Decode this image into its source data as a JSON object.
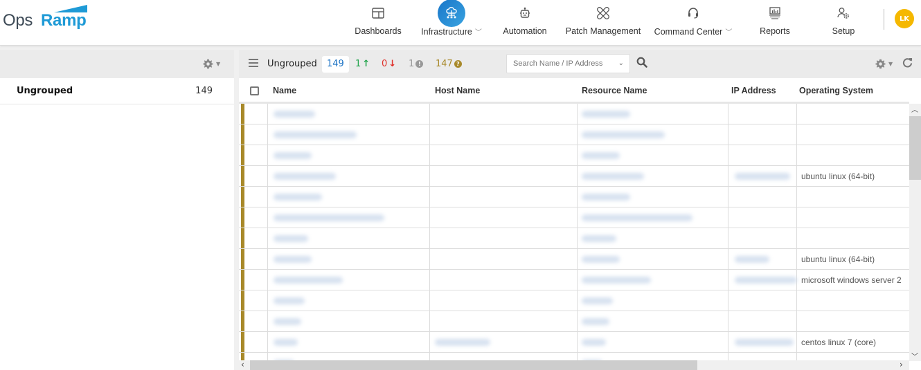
{
  "logo": {
    "part1": "Ops",
    "part2": "Ramp"
  },
  "nav": [
    {
      "label": "Dashboards",
      "icon": "dashboard-icon",
      "active": false,
      "dropdown": false
    },
    {
      "label": "Infrastructure",
      "icon": "cloud-network-icon",
      "active": true,
      "dropdown": true
    },
    {
      "label": "Automation",
      "icon": "robot-icon",
      "active": false,
      "dropdown": false
    },
    {
      "label": "Patch Management",
      "icon": "bandage-icon",
      "active": false,
      "dropdown": false
    },
    {
      "label": "Command Center",
      "icon": "headset-icon",
      "active": false,
      "dropdown": true
    },
    {
      "label": "Reports",
      "icon": "report-icon",
      "active": false,
      "dropdown": false
    },
    {
      "label": "Setup",
      "icon": "user-gear-icon",
      "active": false,
      "dropdown": false
    }
  ],
  "user": {
    "initials": "LK"
  },
  "colors": {
    "brand": "#1e9ad6",
    "active_nav": "#1976c9",
    "avatar": "#f5b800",
    "row_status": "#a8892a",
    "up": "#1fa34a",
    "down": "#e0302a",
    "unknown": "#999999",
    "undefined": "#a8892a",
    "count": "#1a72c4"
  },
  "left": {
    "groups": [
      {
        "name": "Ungrouped",
        "count": "149"
      }
    ]
  },
  "toolbar": {
    "group_label": "Ungrouped",
    "total": "149",
    "up": "1",
    "down": "0",
    "unknown": "1",
    "undefined": "147",
    "search_placeholder": "Search Name / IP Address"
  },
  "table": {
    "columns": [
      "Name",
      "Host Name",
      "Resource Name",
      "IP Address",
      "Operating System"
    ],
    "rows": [
      {
        "os": ""
      },
      {
        "os": ""
      },
      {
        "os": ""
      },
      {
        "os": "ubuntu linux (64-bit)"
      },
      {
        "os": ""
      },
      {
        "os": ""
      },
      {
        "os": ""
      },
      {
        "os": "ubuntu linux (64-bit)"
      },
      {
        "os": "microsoft windows server 2"
      },
      {
        "os": ""
      },
      {
        "os": ""
      },
      {
        "os": "centos linux 7 (core)"
      },
      {
        "os": ""
      }
    ]
  }
}
